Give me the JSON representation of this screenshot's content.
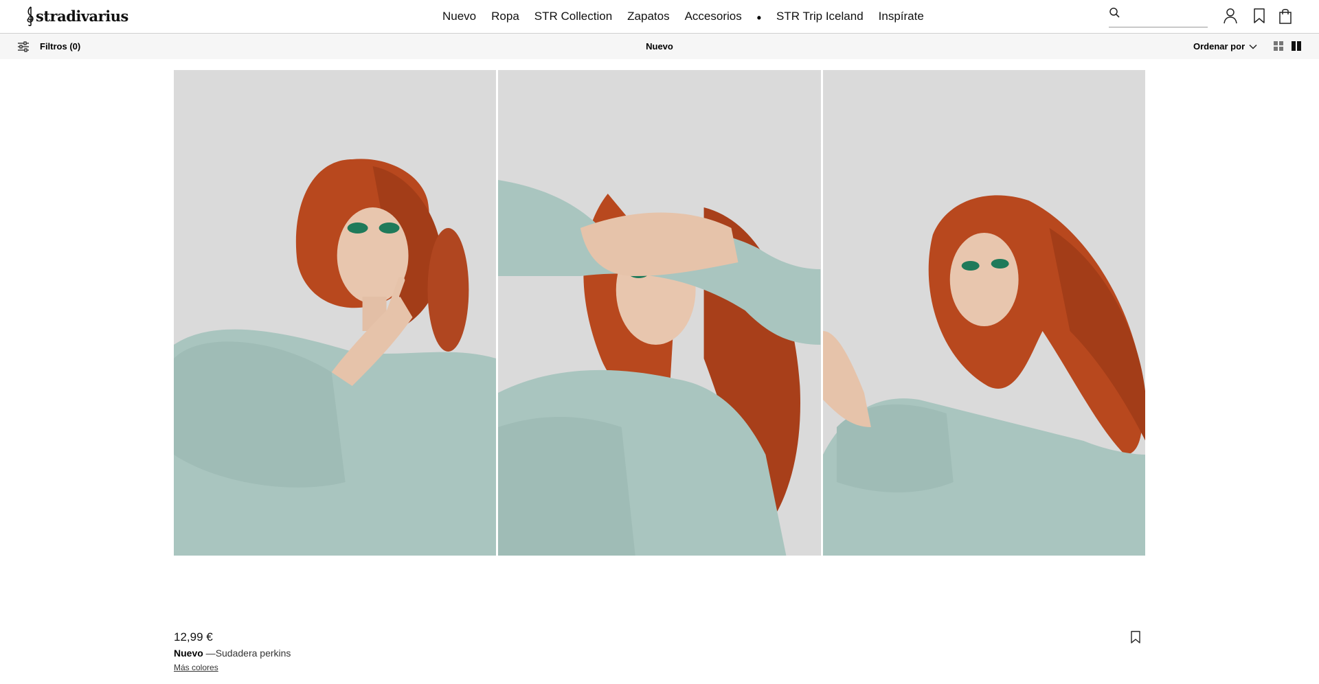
{
  "header": {
    "brand": "stradivarius",
    "nav": [
      "Nuevo",
      "Ropa",
      "STR Collection",
      "Zapatos",
      "Accesorios",
      "STR Trip Iceland",
      "Inspírate"
    ],
    "nav_separator": "•",
    "search": {
      "placeholder": "",
      "value": ""
    },
    "icons": [
      "search-icon",
      "user-icon",
      "bookmark-icon",
      "shopping-bag-icon"
    ]
  },
  "subbar": {
    "filters_label": "Filtros (0)",
    "title": "Nuevo",
    "sort_label": "Ordenar por",
    "view_icons": [
      "grid-small-view-icon",
      "grid-large-view-icon"
    ]
  },
  "product": {
    "price": "12,99 €",
    "tag": "Nuevo",
    "separator": " —",
    "name": "Sudadera perkins",
    "more_colors": "Más colores"
  },
  "colors": {
    "sweater": "#a9c5bf",
    "hair": "#b8481e",
    "background": "#dcdcdc",
    "eyeshadow": "#1f7a5a"
  }
}
